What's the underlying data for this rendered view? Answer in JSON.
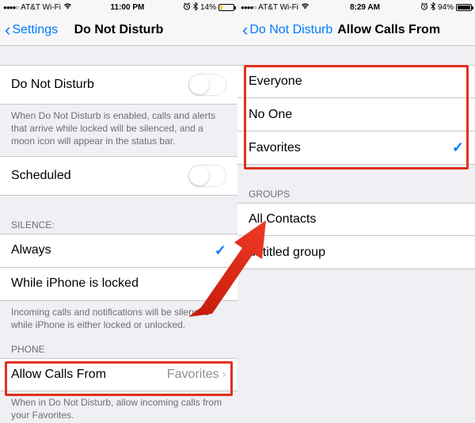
{
  "left": {
    "status": {
      "carrier": "AT&T Wi-Fi",
      "time": "11:00 PM",
      "bt": "14%",
      "alarm": "⏰",
      "wifi": "📶"
    },
    "nav": {
      "back": "Settings",
      "title": "Do Not Disturb"
    },
    "dnd": {
      "label": "Do Not Disturb",
      "footer": "When Do Not Disturb is enabled, calls and alerts that arrive while locked will be silenced, and a moon icon will appear in the status bar."
    },
    "scheduled": {
      "label": "Scheduled"
    },
    "silence": {
      "header": "SILENCE:",
      "always": "Always",
      "locked": "While iPhone is locked",
      "footer": "Incoming calls and notifications will be silenced while iPhone is either locked or unlocked."
    },
    "phone": {
      "header": "PHONE",
      "allow_label": "Allow Calls From",
      "allow_value": "Favorites",
      "footer": "When in Do Not Disturb, allow incoming calls from your Favorites."
    }
  },
  "right": {
    "status": {
      "carrier": "AT&T Wi-Fi",
      "time": "8:29 AM",
      "bt": "94%"
    },
    "nav": {
      "back": "Do Not Disturb",
      "title": "Allow Calls From"
    },
    "options": {
      "everyone": "Everyone",
      "noone": "No One",
      "favorites": "Favorites"
    },
    "groups": {
      "header": "GROUPS",
      "all": "All Contacts",
      "untitled": "untitled group"
    }
  }
}
